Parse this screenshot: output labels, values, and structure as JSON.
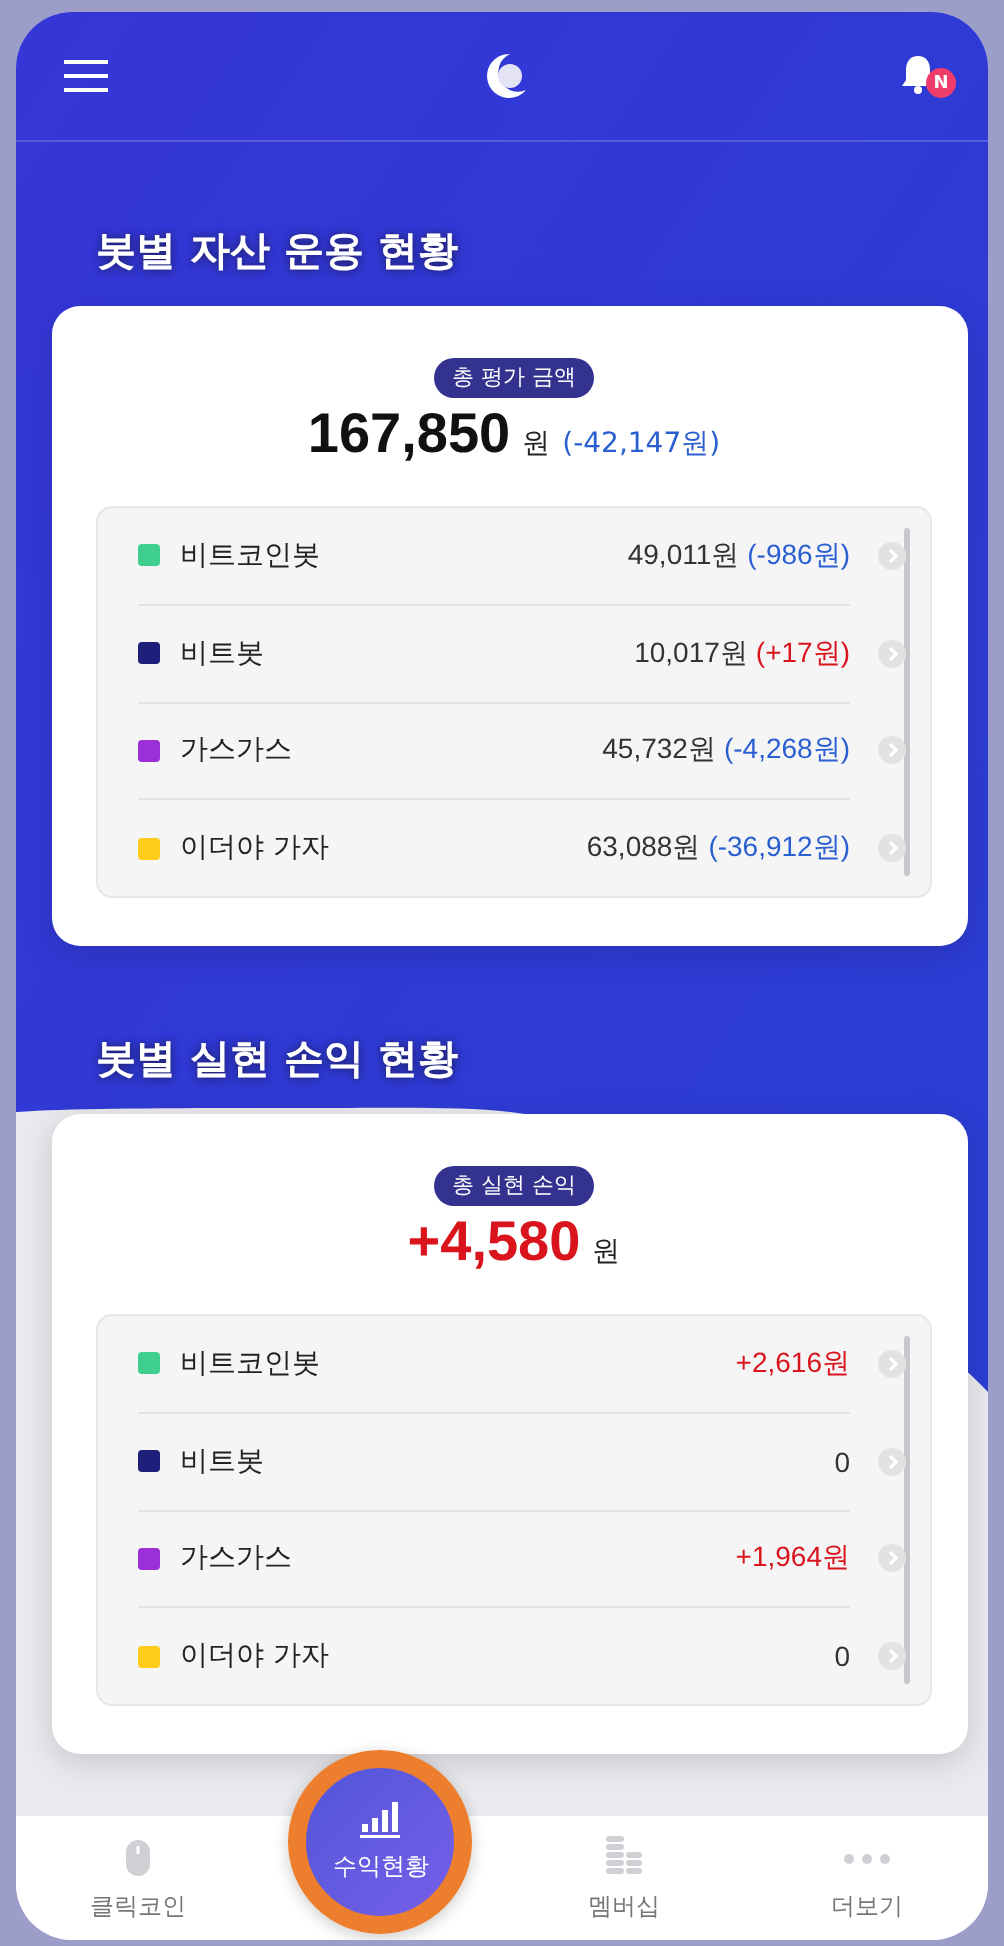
{
  "header": {
    "notification_badge": "N"
  },
  "assets": {
    "title": "봇별 자산 운용 현황",
    "pill": "총 평가 금액",
    "total": {
      "text": "167,850"
    },
    "unit": "원",
    "change": {
      "text": "(-42,147원)",
      "color": "#2a5fd1"
    },
    "rows": [
      {
        "name": "비트코인봇",
        "color": "#3ecf8e",
        "value": {
          "text": "49,011원"
        },
        "change": {
          "text": "(-986원)",
          "color": "#2a5fd1"
        }
      },
      {
        "name": "비트봇",
        "color": "#1d1f7a",
        "value": {
          "text": "10,017원"
        },
        "change": {
          "text": "(+17원)",
          "color": "#d9141c"
        }
      },
      {
        "name": "가스가스",
        "color": "#9b30d9",
        "value": {
          "text": "45,732원"
        },
        "change": {
          "text": "(-4,268원)",
          "color": "#2a5fd1"
        }
      },
      {
        "name": "이더야 가자",
        "color": "#ffcc1a",
        "value": {
          "text": "63,088원"
        },
        "change": {
          "text": "(-36,912원)",
          "color": "#2a5fd1"
        }
      }
    ]
  },
  "realized": {
    "title": "봇별 실현 손익 현황",
    "pill": "총 실현 손익",
    "total": {
      "text": "+4,580",
      "color": "#d9141c"
    },
    "unit": "원",
    "rows": [
      {
        "name": "비트코인봇",
        "color": "#3ecf8e",
        "value": {
          "text": "+2,616원",
          "color": "#d9141c"
        }
      },
      {
        "name": "비트봇",
        "color": "#1d1f7a",
        "value": {
          "text": "0",
          "color": "#333333"
        }
      },
      {
        "name": "가스가스",
        "color": "#9b30d9",
        "value": {
          "text": "+1,964원",
          "color": "#d9141c"
        }
      },
      {
        "name": "이더야 가자",
        "color": "#ffcc1a",
        "value": {
          "text": "0",
          "color": "#333333"
        }
      }
    ]
  },
  "nav": [
    {
      "label": "클릭코인",
      "selected": false
    },
    {
      "label": "수익현황",
      "selected": true
    },
    {
      "label": "멤버십",
      "selected": false
    },
    {
      "label": "더보기",
      "selected": false
    }
  ]
}
